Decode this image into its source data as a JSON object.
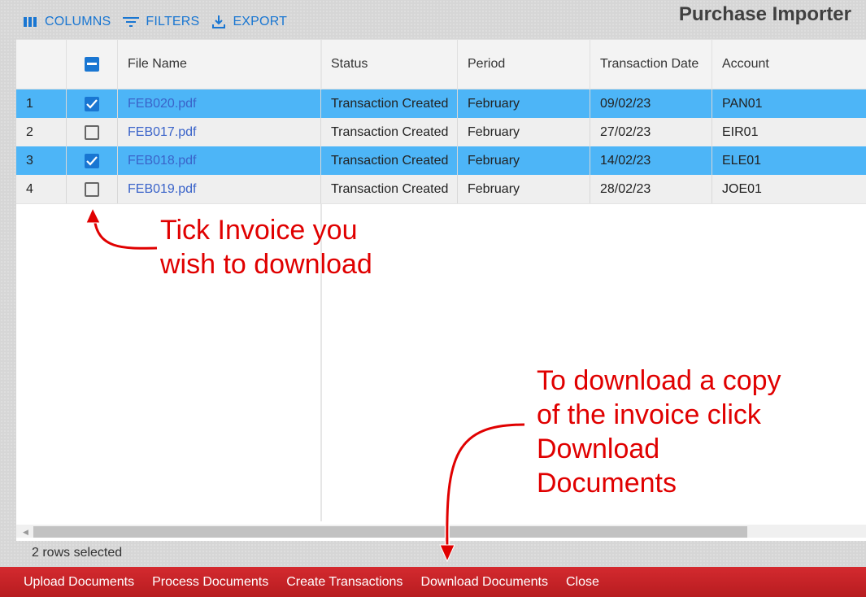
{
  "toolbar": {
    "columns_label": "COLUMNS",
    "filters_label": "FILTERS",
    "export_label": "EXPORT",
    "accent_color": "#1976d2"
  },
  "app_title": "Purchase Importer",
  "grid": {
    "headers": {
      "file_name": "File Name",
      "status": "Status",
      "period": "Period",
      "transaction_date": "Transaction Date",
      "account": "Account"
    },
    "header_checkbox_state": "indeterminate",
    "rows": [
      {
        "num": "1",
        "checked": true,
        "file": "FEB020.pdf",
        "status": "Transaction Created",
        "period": "February",
        "date": "09/02/23",
        "account": "PAN01"
      },
      {
        "num": "2",
        "checked": false,
        "file": "FEB017.pdf",
        "status": "Transaction Created",
        "period": "February",
        "date": "27/02/23",
        "account": "EIR01"
      },
      {
        "num": "3",
        "checked": true,
        "file": "FEB018.pdf",
        "status": "Transaction Created",
        "period": "February",
        "date": "14/02/23",
        "account": "ELE01"
      },
      {
        "num": "4",
        "checked": false,
        "file": "FEB019.pdf",
        "status": "Transaction Created",
        "period": "February",
        "date": "28/02/23",
        "account": "JOE01"
      }
    ],
    "selected_row_color": "#4db5f7"
  },
  "status_text": "2 rows selected",
  "actions": [
    "Upload Documents",
    "Process Documents",
    "Create Transactions",
    "Download Documents",
    "Close"
  ],
  "annotations": {
    "tick_note": [
      "Tick Invoice you",
      "wish to download"
    ],
    "download_note": [
      "To download a copy",
      "of the invoice click",
      "Download",
      "Documents"
    ],
    "color": "#e00000"
  },
  "action_bar_color": "#c62026"
}
